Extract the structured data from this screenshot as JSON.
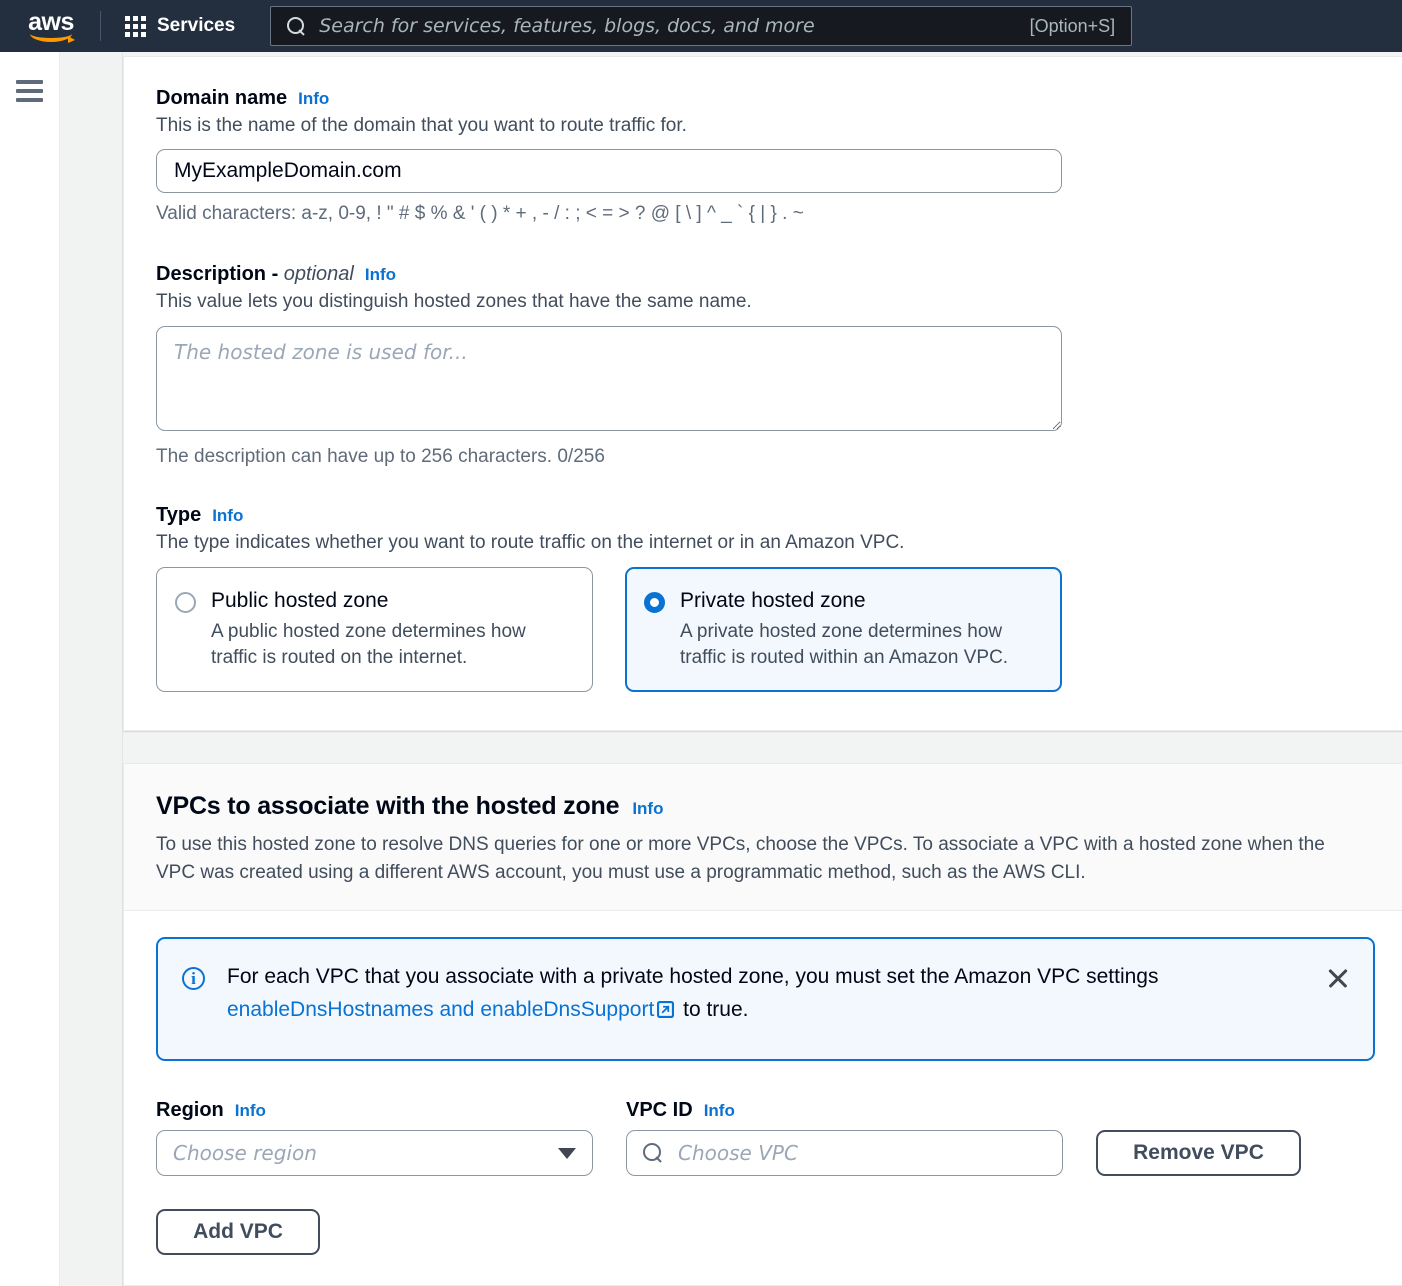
{
  "topnav": {
    "logo_text": "aws",
    "services_label": "Services",
    "search_placeholder": "Search for services, features, blogs, docs, and more",
    "search_shortcut": "[Option+S]",
    "search_value": ""
  },
  "form": {
    "domain": {
      "label": "Domain name",
      "info": "Info",
      "description": "This is the name of the domain that you want to route traffic for.",
      "value": "MyExampleDomain.com",
      "constraint": "Valid characters: a-z, 0-9, ! \" # $ % & ' ( ) * + , - / : ; < = > ? @ [ \\ ] ^ _ ` { | } . ~"
    },
    "description": {
      "label": "Description - ",
      "label_optional": "optional",
      "info": "Info",
      "description": "This value lets you distinguish hosted zones that have the same name.",
      "placeholder": "The hosted zone is used for...",
      "value": "",
      "constraint": "The description can have up to 256 characters. 0/256"
    },
    "type": {
      "label": "Type",
      "info": "Info",
      "description": "The type indicates whether you want to route traffic on the internet or in an Amazon VPC.",
      "options": [
        {
          "title": "Public hosted zone",
          "desc": "A public hosted zone determines how traffic is routed on the internet.",
          "selected": false
        },
        {
          "title": "Private hosted zone",
          "desc": "A private hosted zone determines how traffic is routed within an Amazon VPC.",
          "selected": true
        }
      ]
    }
  },
  "vpc_section": {
    "title": "VPCs to associate with the hosted zone",
    "info": "Info",
    "description": "To use this hosted zone to resolve DNS queries for one or more VPCs, choose the VPCs. To associate a VPC with a hosted zone when the VPC was created using a different AWS account, you must use a programmatic method, such as the AWS CLI.",
    "alert": {
      "text_before": "For each VPC that you associate with a private hosted zone, you must set the Amazon VPC settings ",
      "link_text": "enableDnsHostnames and enableDnsSupport",
      "text_after": " to true."
    },
    "region": {
      "label": "Region",
      "info": "Info",
      "placeholder": "Choose region",
      "value": ""
    },
    "vpc_id": {
      "label": "VPC ID",
      "info": "Info",
      "placeholder": "Choose VPC",
      "value": ""
    },
    "remove_button": "Remove VPC",
    "add_button": "Add VPC"
  },
  "colors": {
    "nav_bg": "#232f3e",
    "accent_orange": "#ff9900",
    "link_blue": "#0972d3",
    "alert_bg": "#f2f8fd",
    "text_primary": "#000716",
    "text_secondary": "#414d5c"
  }
}
